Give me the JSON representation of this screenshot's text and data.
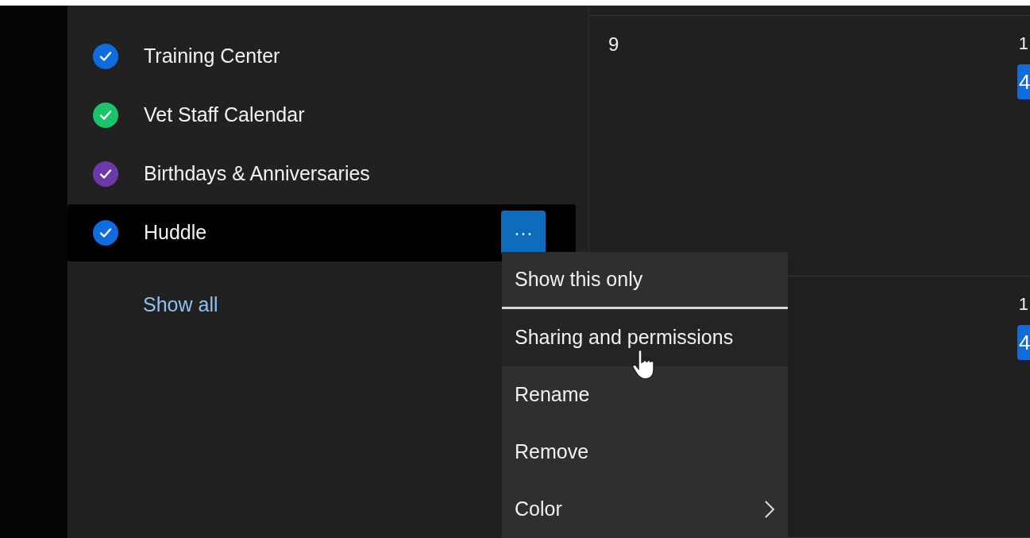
{
  "calendars": [
    {
      "name": "Training Center",
      "color": "#0f6cde",
      "checked": true,
      "selected": false
    },
    {
      "name": "Vet Staff Calendar",
      "color": "#1bc36a",
      "checked": true,
      "selected": false
    },
    {
      "name": "Birthdays & Anniversaries",
      "color": "#6b3aa8",
      "checked": true,
      "selected": false
    },
    {
      "name": "Huddle",
      "color": "#0f6cde",
      "checked": true,
      "selected": true
    }
  ],
  "more_button": {
    "label": "···"
  },
  "show_all": "Show all",
  "context_menu": [
    {
      "label": "Show this only",
      "hovered": false,
      "separator_after": true
    },
    {
      "label": "Sharing and permissions",
      "hovered": true,
      "separator_after": false
    },
    {
      "label": "Rename",
      "hovered": false,
      "separator_after": false
    },
    {
      "label": "Remove",
      "hovered": false,
      "separator_after": false
    },
    {
      "label": "Color",
      "hovered": false,
      "separator_after": false,
      "submenu": true
    }
  ],
  "day_cells": [
    {
      "day": "9"
    },
    {
      "day": "1",
      "badge": "4"
    },
    {
      "day": "1",
      "badge": "4"
    }
  ]
}
